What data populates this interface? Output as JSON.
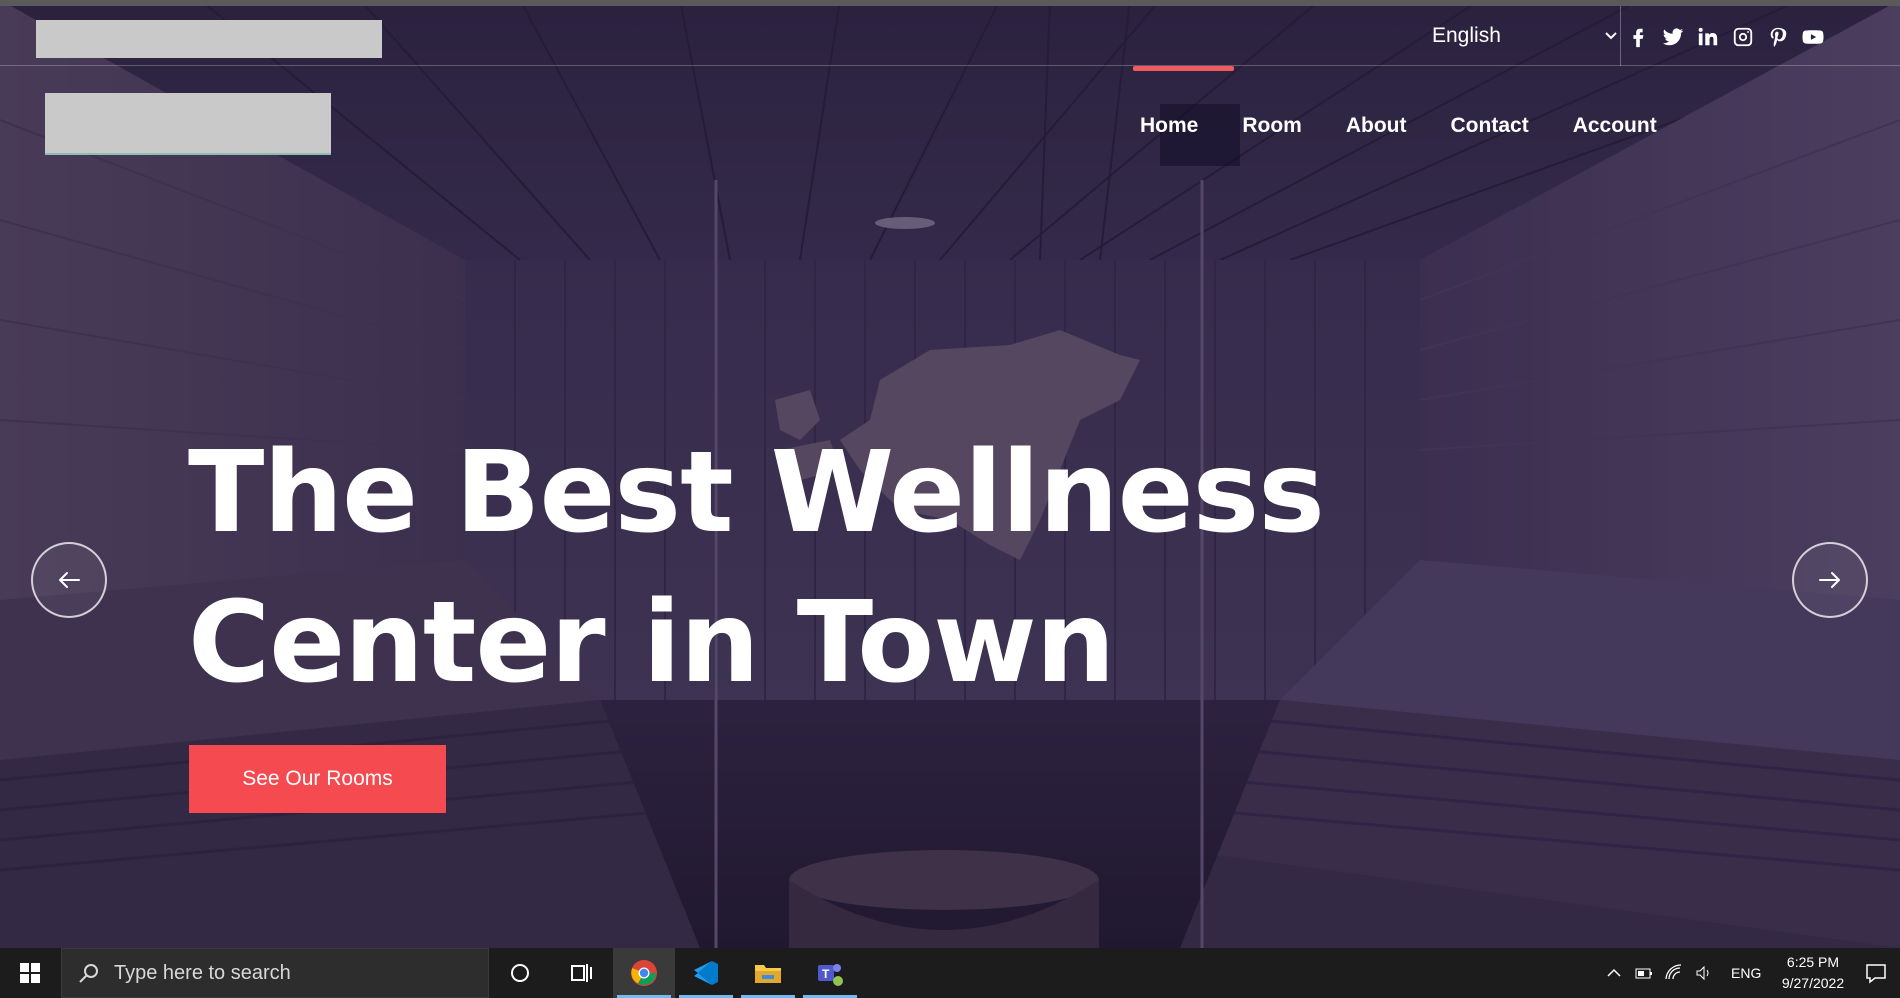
{
  "topbar": {
    "language": "English",
    "socials": [
      "facebook-icon",
      "twitter-icon",
      "linkedin-icon",
      "instagram-icon",
      "pinterest-icon",
      "youtube-icon"
    ]
  },
  "nav": {
    "items": [
      {
        "label": "Home",
        "active": true
      },
      {
        "label": "Room",
        "active": false
      },
      {
        "label": "About",
        "active": false
      },
      {
        "label": "Contact",
        "active": false
      },
      {
        "label": "Account",
        "active": false
      }
    ],
    "accent_color": "#f05b5e"
  },
  "hero": {
    "headline_line1": "The Best Wellness",
    "headline_line2": "Center in Town",
    "cta_label": "See Our Rooms",
    "cta_color": "#f54a4f"
  },
  "taskbar": {
    "search_placeholder": "Type here to search",
    "apps": [
      "cortana-icon",
      "task-view-icon",
      "chrome-icon",
      "vscode-icon",
      "file-explorer-icon",
      "teams-icon"
    ],
    "language": "ENG",
    "time": "6:25 PM",
    "date": "9/27/2022"
  }
}
